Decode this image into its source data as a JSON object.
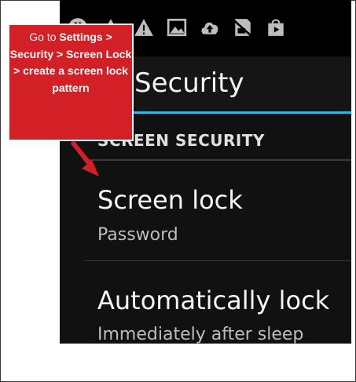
{
  "status_bar": {
    "icons": [
      "pause-circle-icon",
      "warning-icon",
      "warning-icon",
      "image-icon",
      "cloud-upload-icon",
      "no-sim-icon",
      "shopping-bag-icon"
    ]
  },
  "action_bar": {
    "title": "Security"
  },
  "section": {
    "header": "SCREEN SECURITY"
  },
  "preferences": [
    {
      "title": "Screen lock",
      "summary": "Password"
    },
    {
      "title": "Automatically lock",
      "summary": "Immediately after sleep"
    }
  ],
  "callout": {
    "prefix": "Go to ",
    "path_bold": "Settings > Security > Screen Lock > create a screen lock pattern",
    "color": "#d32027"
  },
  "colors": {
    "accent": "#33b5e5",
    "phone_background": "#000000",
    "callout_red": "#d32027"
  }
}
